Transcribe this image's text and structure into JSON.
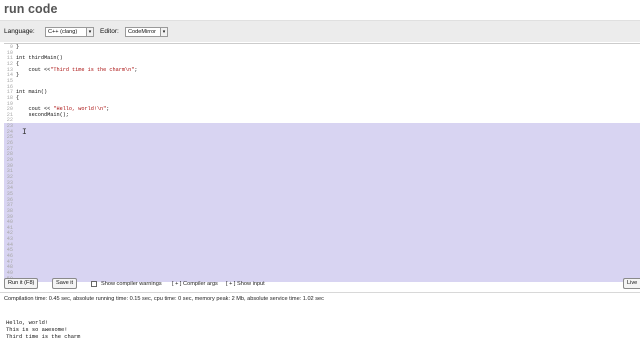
{
  "page": {
    "title": "run code"
  },
  "toolbar": {
    "language_label": "Language:",
    "language_value": "C++ (clang)",
    "editor_label": "Editor:",
    "editor_value": "CodeMirror"
  },
  "editor": {
    "lines": [
      {
        "num": "9",
        "code": "}"
      },
      {
        "num": "10",
        "code": ""
      },
      {
        "num": "11",
        "code": "int thirdMain()"
      },
      {
        "num": "12",
        "code": "{"
      },
      {
        "num": "13",
        "code": "    cout <<\"Third time is the charm\\n\";"
      },
      {
        "num": "14",
        "code": "}"
      },
      {
        "num": "15",
        "code": ""
      },
      {
        "num": "16",
        "code": ""
      },
      {
        "num": "17",
        "code": "int main()"
      },
      {
        "num": "18",
        "code": "{"
      },
      {
        "num": "19",
        "code": ""
      },
      {
        "num": "20",
        "code": "    cout << \"Hello, world!\\n\";"
      },
      {
        "num": "21",
        "code": "    secondMain();"
      },
      {
        "num": "22",
        "code": ""
      },
      {
        "num": "23",
        "code": ""
      },
      {
        "num": "24",
        "code": ""
      },
      {
        "num": "25",
        "code": ""
      },
      {
        "num": "26",
        "code": ""
      },
      {
        "num": "27",
        "code": ""
      },
      {
        "num": "28",
        "code": ""
      },
      {
        "num": "29",
        "code": ""
      },
      {
        "num": "30",
        "code": ""
      },
      {
        "num": "31",
        "code": ""
      },
      {
        "num": "32",
        "code": ""
      },
      {
        "num": "33",
        "code": ""
      },
      {
        "num": "34",
        "code": ""
      },
      {
        "num": "35",
        "code": ""
      },
      {
        "num": "36",
        "code": ""
      },
      {
        "num": "37",
        "code": ""
      },
      {
        "num": "38",
        "code": ""
      },
      {
        "num": "39",
        "code": ""
      },
      {
        "num": "40",
        "code": ""
      },
      {
        "num": "41",
        "code": ""
      },
      {
        "num": "42",
        "code": ""
      },
      {
        "num": "43",
        "code": ""
      },
      {
        "num": "44",
        "code": ""
      },
      {
        "num": "45",
        "code": ""
      },
      {
        "num": "46",
        "code": ""
      },
      {
        "num": "47",
        "code": ""
      },
      {
        "num": "48",
        "code": ""
      },
      {
        "num": "49",
        "code": ""
      },
      {
        "num": "50",
        "code": ""
      }
    ],
    "highlighted_from": 14
  },
  "actions": {
    "run_label": "Run it (F8)",
    "save_label": "Save it",
    "warnings_label": "Show compiler warnings",
    "compiler_args_label": "[ + ] Compiler args",
    "show_input_label": "[ + ] Show input",
    "live_label": "Live"
  },
  "stats": "Compilation time: 0.45 sec, absolute running time: 0.15 sec, cpu time: 0 sec, memory peak: 2 Mb, absolute service time: 1.02 sec",
  "output": {
    "lines": [
      "Hello, world!",
      "This is so awesome!",
      "Third time is the charm"
    ]
  },
  "colors": {
    "highlight": "#d8d4f2",
    "string": "#aa1111",
    "toolbar_bg": "#ececec"
  }
}
